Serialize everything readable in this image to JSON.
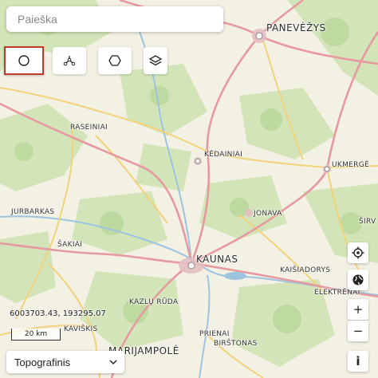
{
  "search": {
    "placeholder": "Paieška"
  },
  "tools": {
    "circle": "circle-icon",
    "line": "polyline-icon",
    "polygon": "hexagon-icon",
    "layers": "layers-icon"
  },
  "cities": {
    "panevezys": "PANEVĖŽYS",
    "raseiniai": "RASEINIAI",
    "kedainiai": "KĖDAINIAI",
    "ukmerge": "UKMERGĖ",
    "jurbarkas": "JURBARKAS",
    "jonava": "JONAVA",
    "sakiai": "ŠAKIAI",
    "sirvintos": "ŠIRV",
    "kaunas": "KAUNAS",
    "kaisiadorys": "KAIŠIADORYS",
    "kazlu_ruda": "KAZLŲ RŪDA",
    "elektrenai": "ELEKTRĖNAI",
    "kaviskis": "KAVIŠKIS",
    "prienai": "PRIENAI",
    "birstonas": "BIRŠTONAS",
    "marijampole": "MARIJAMPOLĖ"
  },
  "coordinates": "6003703.43, 193295.07",
  "scale_label": "20 km",
  "base_layer": "Topografinis",
  "right_controls": {
    "locate": "locate-icon",
    "globe": "globe-icon",
    "zoom_in": "+",
    "zoom_out": "−",
    "info": "i"
  },
  "colors": {
    "active_tool_border": "#c0392b",
    "forest": "#cfe3b4",
    "major_road": "#e69aa0",
    "secondary_road": "#f2d27a"
  }
}
